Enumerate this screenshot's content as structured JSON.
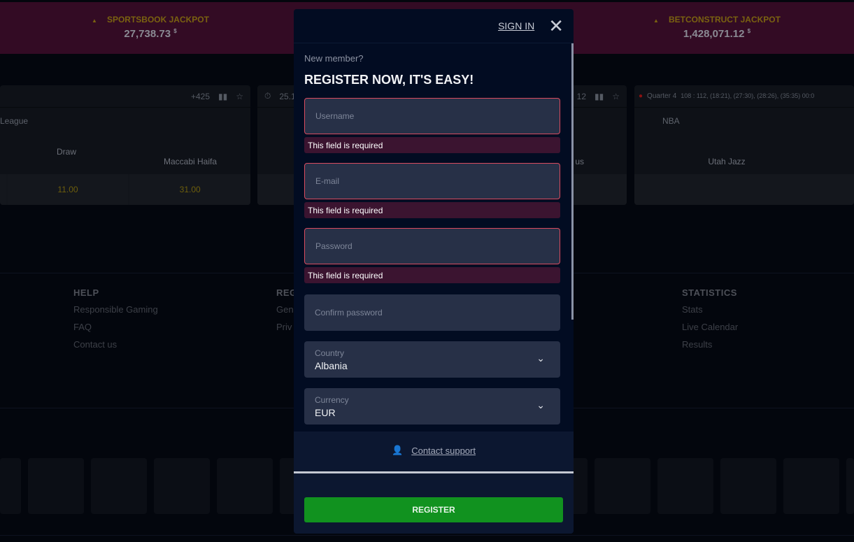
{
  "jackpots": [
    {
      "title": "SPORTSBOOK JACKPOT",
      "amount": "27,738.73",
      "currency": "$"
    },
    {
      "title": "BETCONSTRUCT JACKPOT",
      "amount": "1,428,071.12",
      "currency": "$"
    }
  ],
  "cards": [
    {
      "markets": "+425",
      "league": "League",
      "teams": [
        "Draw",
        "Maccabi Haifa"
      ],
      "odds": [
        "11.00",
        "31.00"
      ]
    },
    {
      "time": "25.1"
    },
    {
      "markets": "12",
      "team": "us"
    },
    {
      "status": "Quarter 4",
      "score": "108 : 112, (18:21), (27:30), (28:26), (35:35) 00:0",
      "league": "NBA",
      "team": "Utah Jazz"
    }
  ],
  "footer": {
    "columns": [
      {
        "title": "HELP",
        "links": [
          "Responsible Gaming",
          "FAQ",
          "Contact us"
        ]
      },
      {
        "title": "REG",
        "links": [
          "Gen",
          "Priv"
        ]
      },
      {
        "title": "STATISTICS",
        "links": [
          "Stats",
          "Live Calendar",
          "Results"
        ]
      }
    ]
  },
  "modal": {
    "sign_in": "SIGN IN",
    "subtitle": "New member?",
    "title": "REGISTER NOW, IT'S EASY!",
    "fields": [
      {
        "placeholder": "Username",
        "error": "This field is required"
      },
      {
        "placeholder": "E-mail",
        "error": "This field is required"
      },
      {
        "placeholder": "Password",
        "error": "This field is required"
      },
      {
        "placeholder": "Confirm password"
      }
    ],
    "country": {
      "label": "Country",
      "value": "Albania"
    },
    "currency": {
      "label": "Currency",
      "value": "EUR"
    },
    "contact_support": "Contact support",
    "register": "REGISTER"
  },
  "colors": {
    "accent_green": "#11921f",
    "error": "#d94b5f",
    "modal_bg": "#020c22"
  }
}
